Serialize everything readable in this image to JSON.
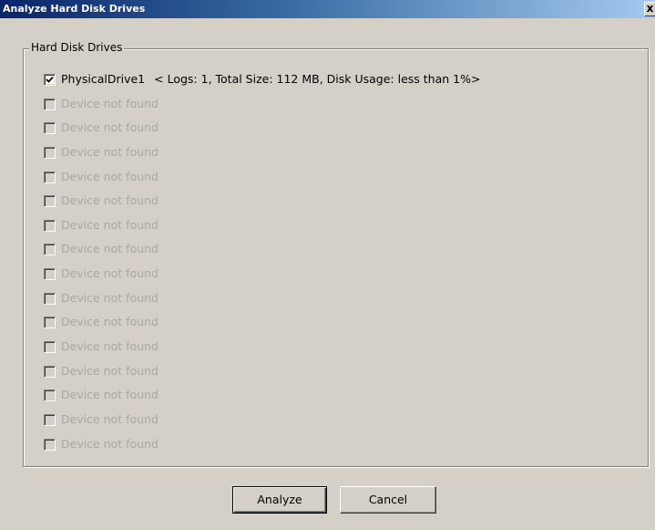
{
  "window": {
    "title": "Analyze Hard Disk Drives",
    "close_glyph": "x"
  },
  "group": {
    "label": "Hard Disk Drives"
  },
  "drives": [
    {
      "label": "PhysicalDrive1",
      "info": "< Logs: 1, Total Size: 112 MB, Disk Usage: less than 1%>",
      "checked": true,
      "enabled": true
    },
    {
      "label": "Device not found",
      "info": "",
      "checked": false,
      "enabled": false
    },
    {
      "label": "Device not found",
      "info": "",
      "checked": false,
      "enabled": false
    },
    {
      "label": "Device not found",
      "info": "",
      "checked": false,
      "enabled": false
    },
    {
      "label": "Device not found",
      "info": "",
      "checked": false,
      "enabled": false
    },
    {
      "label": "Device not found",
      "info": "",
      "checked": false,
      "enabled": false
    },
    {
      "label": "Device not found",
      "info": "",
      "checked": false,
      "enabled": false
    },
    {
      "label": "Device not found",
      "info": "",
      "checked": false,
      "enabled": false
    },
    {
      "label": "Device not found",
      "info": "",
      "checked": false,
      "enabled": false
    },
    {
      "label": "Device not found",
      "info": "",
      "checked": false,
      "enabled": false
    },
    {
      "label": "Device not found",
      "info": "",
      "checked": false,
      "enabled": false
    },
    {
      "label": "Device not found",
      "info": "",
      "checked": false,
      "enabled": false
    },
    {
      "label": "Device not found",
      "info": "",
      "checked": false,
      "enabled": false
    },
    {
      "label": "Device not found",
      "info": "",
      "checked": false,
      "enabled": false
    },
    {
      "label": "Device not found",
      "info": "",
      "checked": false,
      "enabled": false
    },
    {
      "label": "Device not found",
      "info": "",
      "checked": false,
      "enabled": false
    }
  ],
  "buttons": {
    "analyze_label": "Analyze",
    "cancel_label": "Cancel"
  },
  "colors": {
    "dialog_bg": "#d4d0c8",
    "title_bar": "#0a246a",
    "disabled_text": "#a8a8a0"
  }
}
